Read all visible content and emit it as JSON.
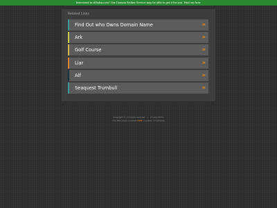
{
  "banner": {
    "text": "Interested in slilsdsn.com? Our Domain Broker Service may be able to get it for you.",
    "cta": "Find out how."
  },
  "panel": {
    "heading": "Related Links",
    "links": [
      {
        "label": "Find Out who Owns Domain Name",
        "accent": "#3a9a9a"
      },
      {
        "label": "Ark",
        "accent": "#c9c94a"
      },
      {
        "label": "Golf Course",
        "accent": "#d9b44a"
      },
      {
        "label": "Liar",
        "accent": "#d9862f"
      },
      {
        "label": "Alf",
        "accent": "#1c3340"
      },
      {
        "label": "Seaquest Trumbull",
        "accent": "#3a9a9a"
      }
    ],
    "arrow": "»"
  },
  "footer": {
    "copyright": "Copyright ©. All rights reserved.",
    "separator": "|",
    "privacy": "Privacy Policy",
    "parked_prefix": "This Web page is parked",
    "parked_link": "FREE",
    "parked_suffix": ", courtesy of GoDaddy"
  },
  "colors": {
    "background": "#2d2d2d",
    "banner": "#2a8a33",
    "panel": "#3d3d3d",
    "link_row": "#5c5c5c",
    "arrow": "#e88a1a"
  },
  "icons": {
    "link_arrow": "double-chevron-right-icon"
  }
}
